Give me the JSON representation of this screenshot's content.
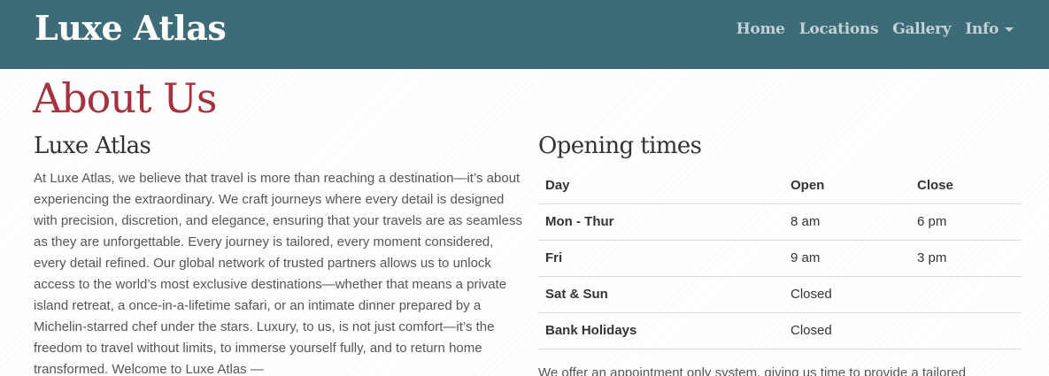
{
  "navbar": {
    "brand": "Luxe Atlas",
    "links": [
      {
        "label": "Home"
      },
      {
        "label": "Locations"
      },
      {
        "label": "Gallery"
      },
      {
        "label": "Info"
      }
    ]
  },
  "page": {
    "title": "About Us"
  },
  "about": {
    "heading": "Luxe Atlas",
    "text": "At Luxe Atlas, we believe that travel is more than reaching a destination—it’s about experiencing the extraordinary. We craft journeys where every detail is designed with precision, discretion, and elegance, ensuring that your travels are as seamless as they are unforgettable. Every journey is tailored, every moment considered, every detail refined. Our global network of trusted partners allows us to unlock access to the world’s most exclusive destinations—whether that means a private island retreat, a once-in-a-lifetime safari, or an intimate dinner prepared by a Michelin-starred chef under the stars. Luxury, to us, is not just comfort—it’s the freedom to travel without limits, to immerse yourself fully, and to return home transformed. Welcome to Luxe Atlas —"
  },
  "hours": {
    "heading": "Opening times",
    "columns": [
      "Day",
      "Open",
      "Close"
    ],
    "rows": [
      {
        "day": "Mon - Thur",
        "open": "8 am",
        "close": "6 pm"
      },
      {
        "day": "Fri",
        "open": "9 am",
        "close": "3 pm"
      },
      {
        "day": "Sat & Sun",
        "open": "Closed",
        "close": ""
      },
      {
        "day": "Bank Holidays",
        "open": "Closed",
        "close": ""
      }
    ],
    "note": "We offer an appointment only system, giving us time to provide a tailored"
  },
  "colors": {
    "navbar_bg": "#3e6b78",
    "title_accent": "#a3343f",
    "nav_link": "#c3d2d7"
  }
}
